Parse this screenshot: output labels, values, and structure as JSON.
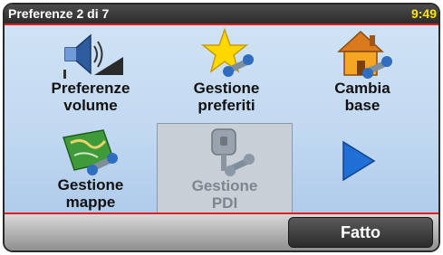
{
  "header": {
    "title": "Preferenze 2 di 7",
    "time": "9:49"
  },
  "menu": {
    "items": [
      {
        "label": "Preferenze\nvolume",
        "icon": "volume-icon",
        "selected": false
      },
      {
        "label": "Gestione\npreferiti",
        "icon": "favorites-star-icon",
        "selected": false
      },
      {
        "label": "Cambia\nbase",
        "icon": "home-icon",
        "selected": false
      },
      {
        "label": "Gestione\nmappe",
        "icon": "map-icon",
        "selected": false
      },
      {
        "label": "Gestione\nPDI",
        "icon": "poi-icon",
        "selected": true
      }
    ],
    "next_icon": "next-page-arrow-icon"
  },
  "footer": {
    "done_label": "Fatto"
  },
  "colors": {
    "accent_line": "#e11d1d",
    "clock": "#ffe600",
    "arrow": "#1f6fd6"
  }
}
